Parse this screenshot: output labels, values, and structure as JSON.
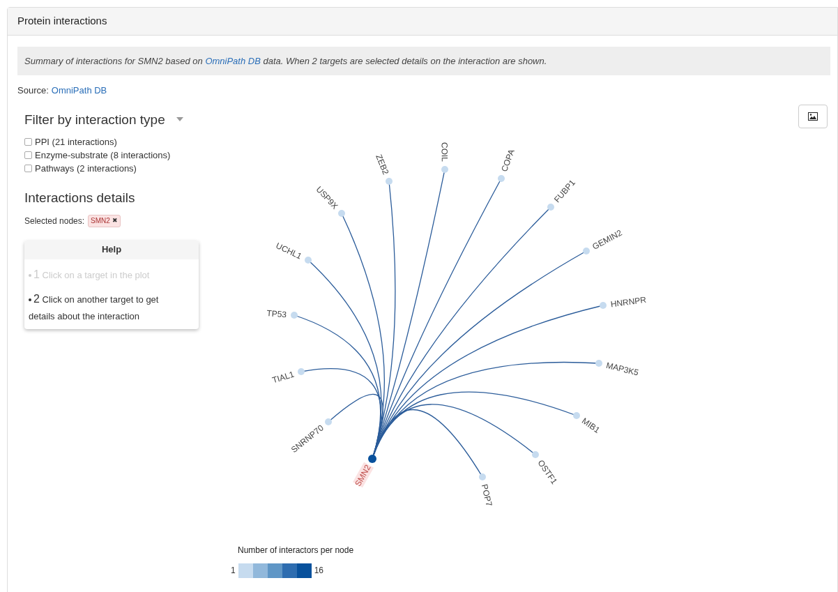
{
  "panel": {
    "title": "Protein interactions"
  },
  "summary": {
    "before": "Summary of interactions for SMN2 based on ",
    "link": "OmniPath DB",
    "after": " data. When 2 targets are selected details on the interaction are shown."
  },
  "source": {
    "label": "Source:",
    "link": "OmniPath DB"
  },
  "filter": {
    "title": "Filter by interaction type",
    "options": [
      {
        "label": "PPI (21 interactions)",
        "checked": false
      },
      {
        "label": "Enzyme-substrate (8 interactions)",
        "checked": false
      },
      {
        "label": "Pathways (2 interactions)",
        "checked": false
      }
    ]
  },
  "details": {
    "title": "Interactions details",
    "selected_label": "Selected nodes:",
    "tags": [
      {
        "label": "SMN2",
        "remove": "✖"
      }
    ]
  },
  "help": {
    "title": "Help",
    "steps": [
      {
        "number": "1",
        "text": "Click on a target in the plot",
        "done": true
      },
      {
        "number": "2",
        "text": "Click on another target to get details about the interaction",
        "done": false
      }
    ]
  },
  "network": {
    "nodes": [
      {
        "label": "SMN2",
        "color": "#08519c",
        "selected": true
      },
      {
        "label": "SNRNP70",
        "color": "#c6dbef",
        "selected": false
      },
      {
        "label": "TIAL1",
        "color": "#c6dbef",
        "selected": false
      },
      {
        "label": "TP53",
        "color": "#c6dbef",
        "selected": false
      },
      {
        "label": "UCHL1",
        "color": "#c6dbef",
        "selected": false
      },
      {
        "label": "USP9X",
        "color": "#c6dbef",
        "selected": false
      },
      {
        "label": "ZEB2",
        "color": "#c6dbef",
        "selected": false
      },
      {
        "label": "COIL",
        "color": "#c6dbef",
        "selected": false
      },
      {
        "label": "COPA",
        "color": "#c6dbef",
        "selected": false
      },
      {
        "label": "FUBP1",
        "color": "#c6dbef",
        "selected": false
      },
      {
        "label": "GEMIN2",
        "color": "#c6dbef",
        "selected": false
      },
      {
        "label": "HNRNPR",
        "color": "#c6dbef",
        "selected": false
      },
      {
        "label": "MAP3K5",
        "color": "#c6dbef",
        "selected": false
      },
      {
        "label": "MIB1",
        "color": "#c6dbef",
        "selected": false
      },
      {
        "label": "OSTF1",
        "color": "#c6dbef",
        "selected": false
      },
      {
        "label": "POP7",
        "color": "#c6dbef",
        "selected": false
      }
    ]
  },
  "legend": {
    "title": "Number of interactors per node",
    "min": "1",
    "max": "16",
    "swatches": [
      {
        "color": "#c6dbef"
      },
      {
        "color": "#91b8db"
      },
      {
        "color": "#5f96c6"
      },
      {
        "color": "#2e6db0"
      },
      {
        "color": "#08519c"
      }
    ]
  }
}
